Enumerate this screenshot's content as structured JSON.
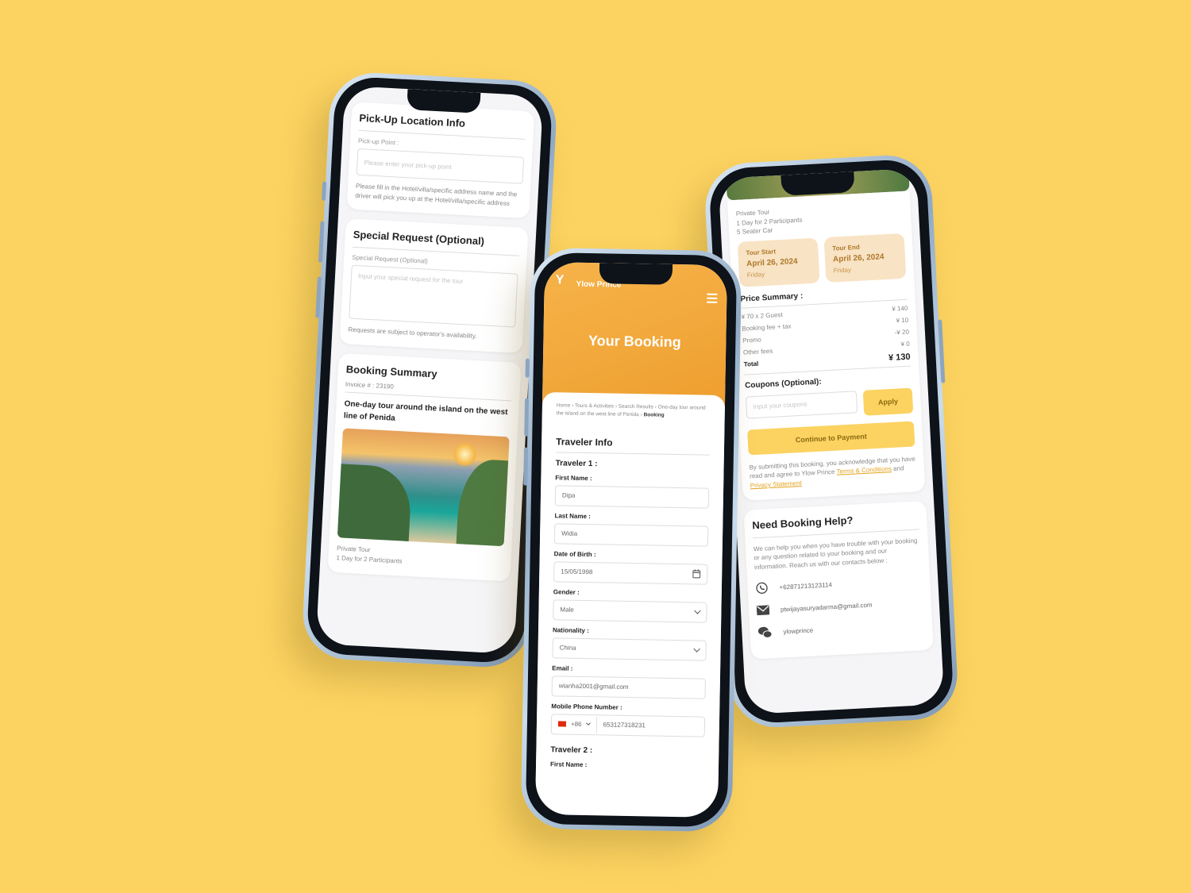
{
  "colors": {
    "background": "#FCD361",
    "accent": "#F2A83B",
    "button_yellow": "#FCD361",
    "date_card": "#F8E3C4"
  },
  "left": {
    "pickup": {
      "title": "Pick-Up Location Info",
      "label": "Pick-up Point :",
      "placeholder": "Please enter your pick-up point",
      "note": "Please fill in the Hotel/villa/specific address name and the driver will pick you up at the Hotel/villa/specific address"
    },
    "special": {
      "title": "Special Request (Optional)",
      "label": "Special Request (Optional)",
      "placeholder": "Input your special request for the tour",
      "note": "Requests are subject to operator's availability."
    },
    "summary": {
      "title": "Booking Summary",
      "invoice_label": "Invoice # :",
      "invoice": "23190",
      "tour_title": "One-day tour around the island on the west line of Penida",
      "tour_type": "Private Tour",
      "tour_days": "1 Day for 2 Participants"
    }
  },
  "center": {
    "brand": "Ylow Prince",
    "header_title": "Your Booking",
    "breadcrumb": "Home › Tours & Activities › Search Results › One-day tour around the island on the west line of Penida › ",
    "breadcrumb_current": "Booking",
    "section_title": "Traveler Info",
    "traveler1": "Traveler 1 :",
    "first_name_label": "First Name :",
    "first_name": "Dipa",
    "last_name_label": "Last Name :",
    "last_name": "Widia",
    "dob_label": "Date of Birth :",
    "dob": "15/05/1998",
    "gender_label": "Gender :",
    "gender": "Male",
    "nationality_label": "Nationality :",
    "nationality": "China",
    "email_label": "Email :",
    "email": "wianha2001@gmail.com",
    "phone_label": "Mobile Phone Number :",
    "phone_code": "+86",
    "phone": "653127318231",
    "traveler2": "Traveler 2 :",
    "first_name_label2": "First Name :"
  },
  "right": {
    "tour_type": "Private Tour",
    "tour_days": "1 Day for 2 Participants",
    "vehicle": "5 Seater Car",
    "start": {
      "label": "Tour Start",
      "date": "April 26, 2024",
      "day": "Friday"
    },
    "end": {
      "label": "Tour End",
      "date": "April 26, 2024",
      "day": "Friday"
    },
    "price": {
      "title": "Price Summary :",
      "guest_label": "¥ 70 x 2 Guest",
      "guest_value": "¥ 140",
      "fee_label": "Booking fee + tax",
      "fee_value": "¥ 10",
      "promo_label": "Promo",
      "promo_value": "-¥ 20",
      "other_label": "Other fees",
      "other_value": "¥ 0",
      "total_label": "Total",
      "total_value": "¥ 130"
    },
    "coupons": {
      "title": "Coupons (Optional):",
      "placeholder": "Input your coupons",
      "apply": "Apply"
    },
    "continue": "Continue to Payment",
    "terms": {
      "prefix": "By submitting this booking, you acknowledge that you have read and agree to Ylow Prince ",
      "terms_link": "Terms & Conditions",
      "and": " and ",
      "privacy_link": "Privacy Statement"
    },
    "help": {
      "title": "Need Booking Help?",
      "text": "We can help you when you have trouble with your booking or any question related to your booking and our information. Reach us with our contacts below :",
      "phone": "+62871213123114",
      "email": "ptwijayasuryadarma@gmail.com",
      "wechat": "ylowprince"
    }
  }
}
